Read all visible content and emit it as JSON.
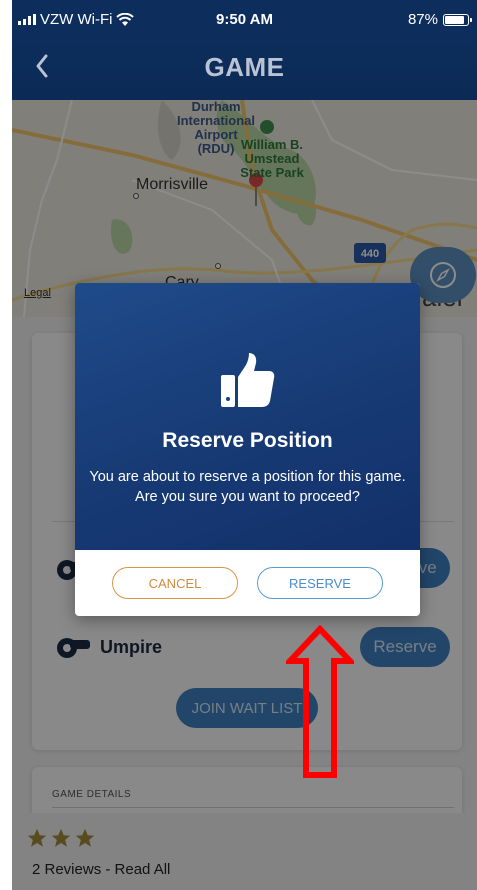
{
  "status_bar": {
    "carrier": "VZW Wi-Fi",
    "time": "9:50 AM",
    "battery": "87%",
    "battery_level": 0.87
  },
  "nav": {
    "title": "GAME",
    "back_icon": "chevron-left-icon"
  },
  "map": {
    "labels": {
      "airport": "Durham\nInternational\nAirport\n(RDU)",
      "park": "William B.\nUmstead\nState Park",
      "morrisville": "Morrisville",
      "cary": "Cary",
      "raleigh_partial": "alei",
      "highway": "440",
      "legal": "Legal"
    },
    "compass_icon": "compass-icon",
    "pin_icon": "map-pin-icon"
  },
  "background": {
    "roles": [
      {
        "name": "",
        "action": "Reserve"
      },
      {
        "name": "Umpire",
        "action": "Reserve"
      }
    ],
    "join_wait_list": "JOIN WAIT LIST",
    "game_details_header": "GAME DETAILS",
    "rating_stars": 3,
    "reviews_link": "2 Reviews - Read All"
  },
  "modal": {
    "icon": "thumbs-up-icon",
    "title": "Reserve Position",
    "message": "You are about to reserve a position for this game. Are you sure you want to proceed?",
    "cancel_label": "CANCEL",
    "reserve_label": "RESERVE"
  },
  "colors": {
    "nav_bg": "#0d2d5c",
    "modal_gradient_top": "#1f4b8a",
    "modal_gradient_bottom": "#12306a",
    "cancel_accent": "#d99448",
    "reserve_accent": "#5b9bd5",
    "annotation_arrow": "#ff0000",
    "star_color": "#a08a3a"
  }
}
